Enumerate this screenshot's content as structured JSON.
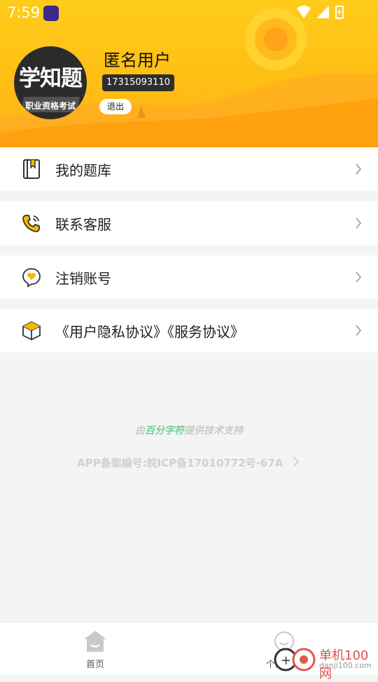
{
  "status_bar": {
    "time": "7:59"
  },
  "profile": {
    "avatar_title": "学知题",
    "avatar_subtitle": "职业资格考试",
    "username": "匿名用户",
    "phone": "17315093110",
    "logout_label": "退出"
  },
  "menu": {
    "items": [
      {
        "label": "我的题库",
        "icon": "book-bookmark-icon"
      },
      {
        "label": "联系客服",
        "icon": "phone-icon"
      },
      {
        "label": "注销账号",
        "icon": "heart-chat-icon"
      },
      {
        "label": "《用户隐私协议》《服务协议》",
        "icon": "box-icon"
      }
    ]
  },
  "footer": {
    "credit_prefix": "由",
    "credit_brand": "百分字符",
    "credit_suffix": "提供技术支持",
    "icp": "APP备案编号:皖ICP备17010772号-67A"
  },
  "tabbar": {
    "tabs": [
      {
        "label": "首页",
        "icon": "home-icon"
      },
      {
        "label": "个人中心",
        "icon": "smile-icon"
      }
    ]
  },
  "watermark": {
    "text": "单机100网",
    "sub": "danji100.com"
  },
  "colors": {
    "header": "#ffc21a",
    "accent_brand": "#6fcf97",
    "dark": "#2b2b2b"
  }
}
